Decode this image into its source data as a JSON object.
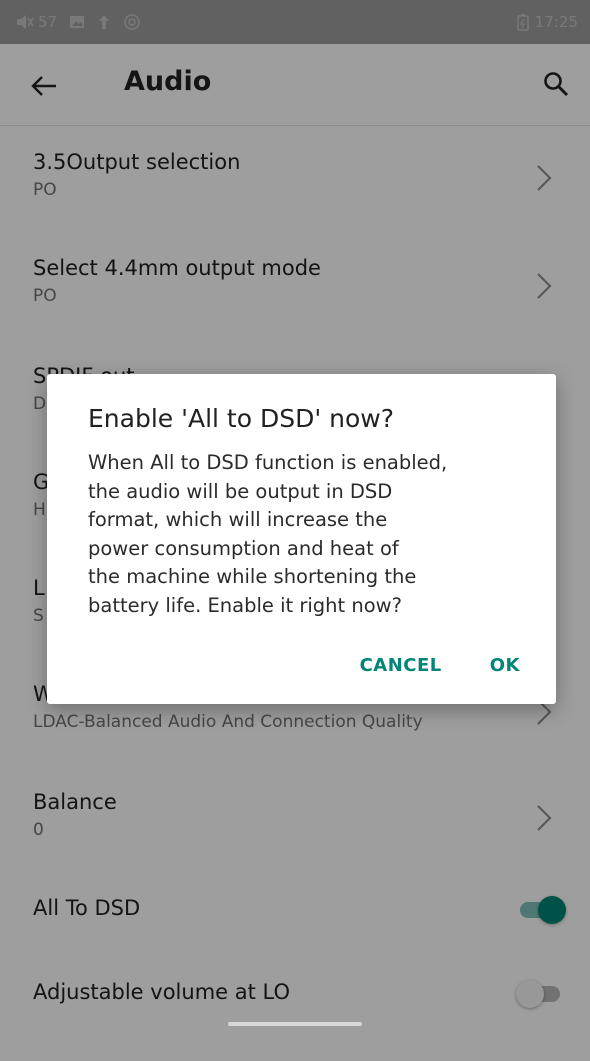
{
  "status_bar": {
    "volume_level": "57",
    "time": "17:25",
    "icons": [
      "volume-icon",
      "image-icon",
      "upload-icon",
      "at-icon",
      "battery-icon"
    ]
  },
  "app_bar": {
    "title": "Audio",
    "back_icon": "arrow-left-icon",
    "search_icon": "search-icon"
  },
  "settings": {
    "items": [
      {
        "title": "3.5Output selection",
        "subtitle": "PO"
      },
      {
        "title": "Select 4.4mm output mode",
        "subtitle": "PO"
      },
      {
        "title": "SPDIF out",
        "subtitle": "D"
      },
      {
        "title": "G",
        "subtitle": "H"
      },
      {
        "title": "L",
        "subtitle": "S"
      },
      {
        "title": "W",
        "subtitle": "LDAC-Balanced Audio And Connection Quality"
      },
      {
        "title": "Balance",
        "subtitle": "0"
      }
    ],
    "toggles": [
      {
        "title": "All To DSD",
        "state": "on"
      },
      {
        "title": "Adjustable volume at LO",
        "state": "off"
      }
    ]
  },
  "dialog": {
    "title": "Enable 'All to DSD' now?",
    "message_lines": [
      "When All to DSD function is enabled,",
      "the audio will be output in DSD",
      "format, which will increase the",
      "power consumption and heat of",
      "the machine while shortening the",
      "battery life. Enable it right now?"
    ],
    "cancel_label": "CANCEL",
    "ok_label": "OK"
  },
  "colors": {
    "accent": "#008577",
    "toggle_on_track": "#80c2bb",
    "toggle_off_track": "#b8b8b8",
    "toggle_off_thumb": "#f5f5f5"
  }
}
